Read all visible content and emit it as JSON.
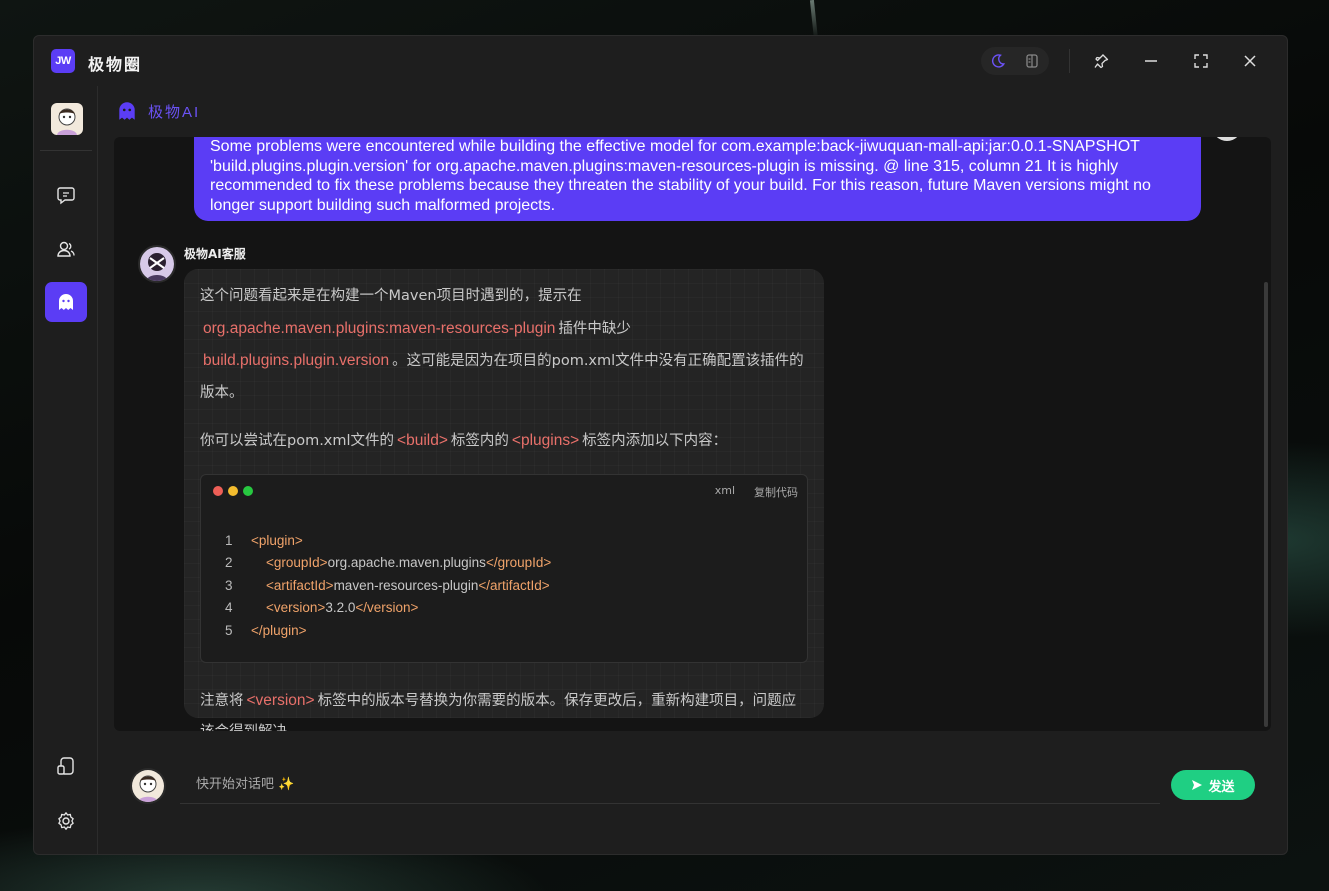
{
  "app": {
    "logo_text": "JW",
    "title": "极物圈"
  },
  "titlebar": {
    "icons": [
      "moon-icon",
      "sidebar-toggle-icon",
      "pin-icon",
      "minimize-icon",
      "maximize-icon",
      "close-icon"
    ]
  },
  "sidebar": {
    "items": [
      {
        "name": "chat",
        "icon": "message-icon",
        "active": false
      },
      {
        "name": "contacts",
        "icon": "users-icon",
        "active": false
      },
      {
        "name": "ai",
        "icon": "ghost-icon",
        "active": true
      },
      {
        "name": "device",
        "icon": "device-icon",
        "active": false
      },
      {
        "name": "settings",
        "icon": "gear-icon",
        "active": false
      }
    ]
  },
  "chat": {
    "header_name": "极物AI",
    "user_message": "Some problems were encountered while building the effective model for com.example:back-jiwuquan-mall-api:jar:0.0.1-SNAPSHOT 'build.plugins.plugin.version' for org.apache.maven.plugins:maven-resources-plugin is missing. @ line 315, column 21 It is highly recommended to fix these problems because they threaten the stability of your build. For this reason, future Maven versions might no longer support building such malformed projects.",
    "bot": {
      "name": "极物AI客服",
      "p1_a": "这个问题看起来是在构建一个Maven项目时遇到的，提示在",
      "p1_code1": "org.apache.maven.plugins:maven-resources-plugin",
      "p1_b": "插件中缺少",
      "p1_code2": "build.plugins.plugin.version",
      "p1_c": "。这可能是因为在项目的pom.xml文件中没有正确配置该插件的版本。",
      "p2_a": "你可以尝试在pom.xml文件的",
      "p2_code1": "<build>",
      "p2_b": "标签内的",
      "p2_code2": "<plugins>",
      "p2_c": "标签内添加以下内容：",
      "code_lang": "xml",
      "copy_label": "复制代码",
      "code_lines": [
        {
          "n": "1",
          "indent": "",
          "open": "<plugin>",
          "text": "",
          "close": ""
        },
        {
          "n": "2",
          "indent": "    ",
          "open": "<groupId>",
          "text": "org.apache.maven.plugins",
          "close": "</groupId>"
        },
        {
          "n": "3",
          "indent": "    ",
          "open": "<artifactId>",
          "text": "maven-resources-plugin",
          "close": "</artifactId>"
        },
        {
          "n": "4",
          "indent": "    ",
          "open": "<version>",
          "text": "3.2.0",
          "close": "</version>"
        },
        {
          "n": "5",
          "indent": "",
          "open": "</plugin>",
          "text": "",
          "close": ""
        }
      ],
      "p3_a": "注意将",
      "p3_code": "<version>",
      "p3_b": "标签中的版本号替换为你需要的版本。保存更改后，重新构建项目，问题应该会得到解决。"
    }
  },
  "input": {
    "placeholder": "快开始对话吧 ✨",
    "value": "",
    "send_label": "发送"
  },
  "colors": {
    "accent": "#5b3df5",
    "send": "#1fcf83",
    "code_text": "#e8706a",
    "xml_tag": "#f0a36a"
  }
}
